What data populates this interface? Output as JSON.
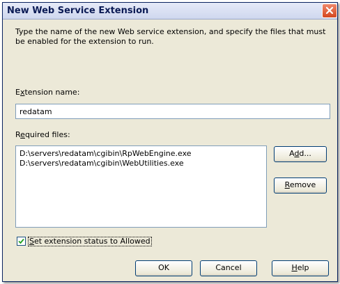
{
  "dialog": {
    "title": "New Web Service Extension",
    "close_icon": "close-icon",
    "description": "Type the name of the new Web service extension, and specify the files that must be enabled for the extension to run.",
    "extension_name": {
      "label_prefix": "E",
      "label_accel": "x",
      "label_rest": "tension name:",
      "value": "redatam"
    },
    "required_files": {
      "label_prefix": "R",
      "label_accel": "e",
      "label_rest": "quired files:",
      "items": [
        "D:\\servers\\redatam\\cgibin\\RpWebEngine.exe",
        "D:\\servers\\redatam\\cgibin\\WebUtilities.exe"
      ]
    },
    "buttons": {
      "add": {
        "prefix": "A",
        "accel": "d",
        "rest": "d..."
      },
      "remove": {
        "prefix": "",
        "accel": "R",
        "rest": "emove"
      },
      "ok": "OK",
      "cancel": "Cancel",
      "help": {
        "prefix": "",
        "accel": "H",
        "rest": "elp"
      }
    },
    "checkbox": {
      "checked": true,
      "accel": "S",
      "rest": "et extension status to Allowed"
    }
  }
}
